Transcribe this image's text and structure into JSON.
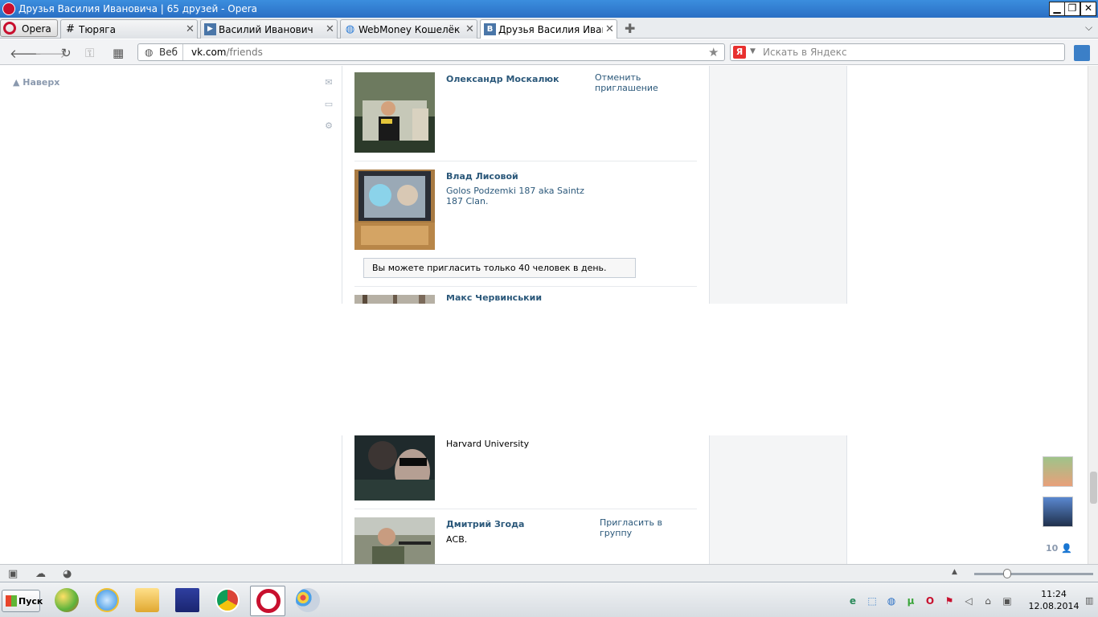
{
  "window": {
    "title": "Друзья Василия Ивановича | 65 друзей - Opera",
    "controls": {
      "minimize": "▁",
      "restore": "❐",
      "close": "✕"
    }
  },
  "tabs": {
    "menu_label": "Opera",
    "items": [
      {
        "label": "Тюряга",
        "icon": "hash-icon",
        "glyph": "#"
      },
      {
        "label": "Василий Иванович",
        "icon": "video-icon",
        "glyph": "▶"
      },
      {
        "label": "WebMoney Кошелёк »...",
        "icon": "globe-icon",
        "glyph": "◍"
      },
      {
        "label": "Друзья Василия Иван...",
        "icon": "vk-icon",
        "glyph": "В"
      }
    ],
    "close_glyph": "✕",
    "new_tab_glyph": "✚",
    "menu_glyph": "⌵"
  },
  "addressbar": {
    "web_label": "Веб",
    "url_host": "vk.com",
    "url_path": "/friends",
    "search_placeholder": "Искать в Яндекс",
    "yandex_glyph": "Я"
  },
  "page": {
    "up_link": "Наверх",
    "friends_top": [
      {
        "name": "Олександр Москалюк",
        "info": "",
        "action": "Отменить приглашение"
      },
      {
        "name": "Влад Лисовой",
        "info": "Golos Podzemki 187 aka Saintz 187 Clan.",
        "action": ""
      },
      {
        "name": "Макс Червинський",
        "info": "",
        "action": ""
      }
    ],
    "notice": "Вы можете пригласить только 40 человек в день.",
    "friends_bottom": [
      {
        "name": "",
        "info": "Harvard University",
        "action": ""
      },
      {
        "name": "Дмитрий Згода",
        "info": "АСВ.",
        "action": "Пригласить в группу"
      }
    ],
    "online_count": "10"
  },
  "taskbar": {
    "start_label": "Пуск",
    "time": "11:24",
    "date": "12.08.2014"
  },
  "colors": {
    "vk_link": "#2b587a",
    "titlebar": "#2a6fc4",
    "opera_red": "#c8102e"
  }
}
